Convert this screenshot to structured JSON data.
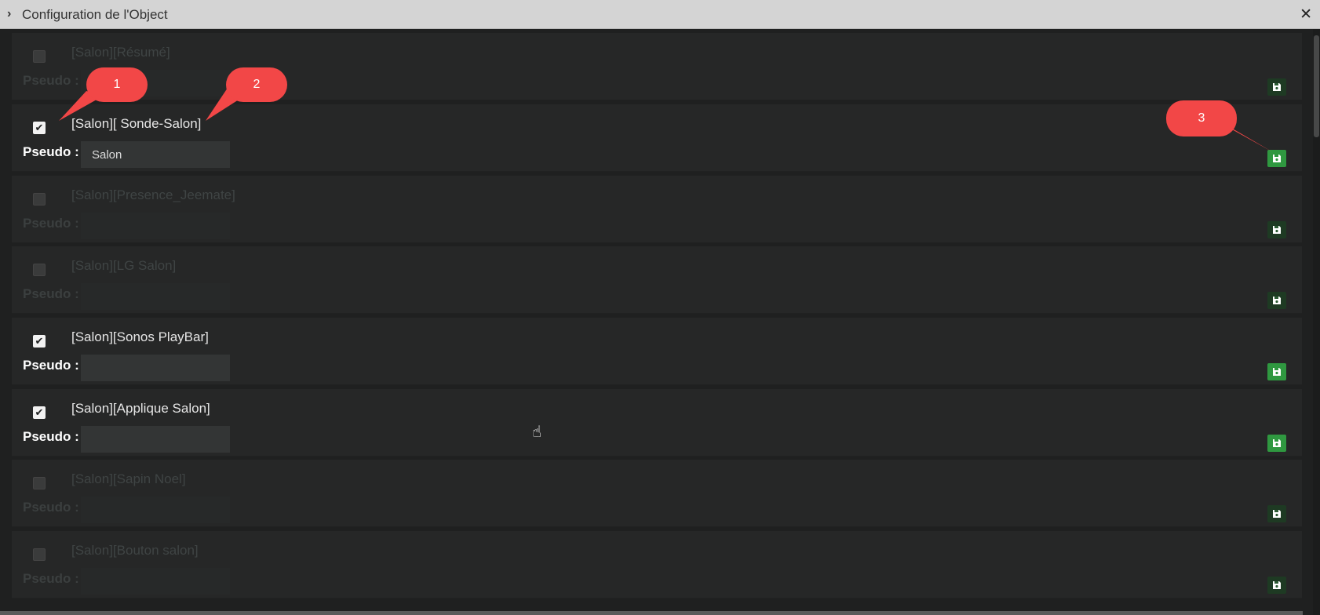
{
  "window": {
    "title": "Configuration de l'Object",
    "close_glyph": "✕",
    "collapse_icon": "chevron-right-icon"
  },
  "pseudo_label": "Pseudo :",
  "rows": [
    {
      "name": "[Salon][Résumé]",
      "checked": false,
      "pseudo_value": ""
    },
    {
      "name": "[Salon][ Sonde-Salon]",
      "checked": true,
      "pseudo_value": "Salon"
    },
    {
      "name": "[Salon][Presence_Jeemate]",
      "checked": false,
      "pseudo_value": ""
    },
    {
      "name": "[Salon][LG Salon]",
      "checked": false,
      "pseudo_value": ""
    },
    {
      "name": "[Salon][Sonos PlayBar]",
      "checked": true,
      "pseudo_value": ""
    },
    {
      "name": "[Salon][Applique Salon]",
      "checked": true,
      "pseudo_value": ""
    },
    {
      "name": "[Salon][Sapin Noel]",
      "checked": false,
      "pseudo_value": ""
    },
    {
      "name": "[Salon][Bouton salon]",
      "checked": false,
      "pseudo_value": ""
    }
  ],
  "callouts": [
    "1",
    "2",
    "3"
  ],
  "colors": {
    "save_active": "#2f9840",
    "callout": "#f24747",
    "titlebar": "#d4d4d4"
  }
}
